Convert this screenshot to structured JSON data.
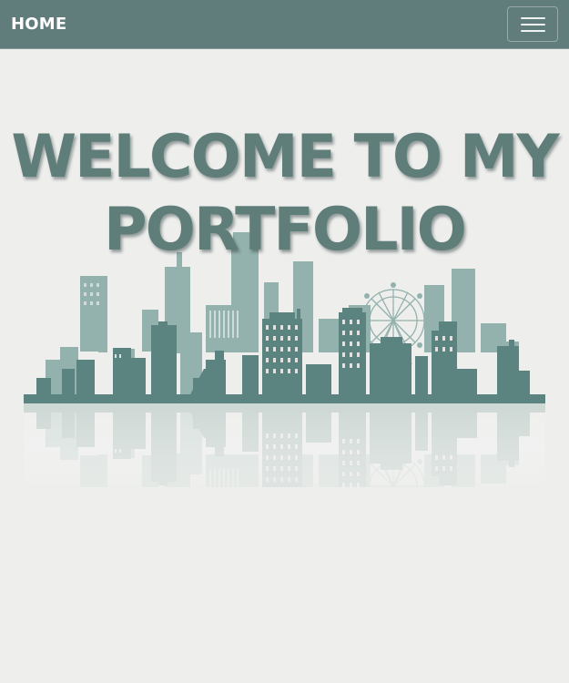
{
  "navbar": {
    "brand_label": "HOME",
    "toggle_icon": "hamburger-menu-icon"
  },
  "hero": {
    "title": "WELCOME TO MY PORTFOLIO",
    "image": "city-skyline-illustration"
  },
  "colors": {
    "navbar_bg": "#607d7b",
    "page_bg": "#eeefed",
    "title": "#5f7d79",
    "skyline_dark": "#5b8480",
    "skyline_light": "#93b1ad"
  }
}
